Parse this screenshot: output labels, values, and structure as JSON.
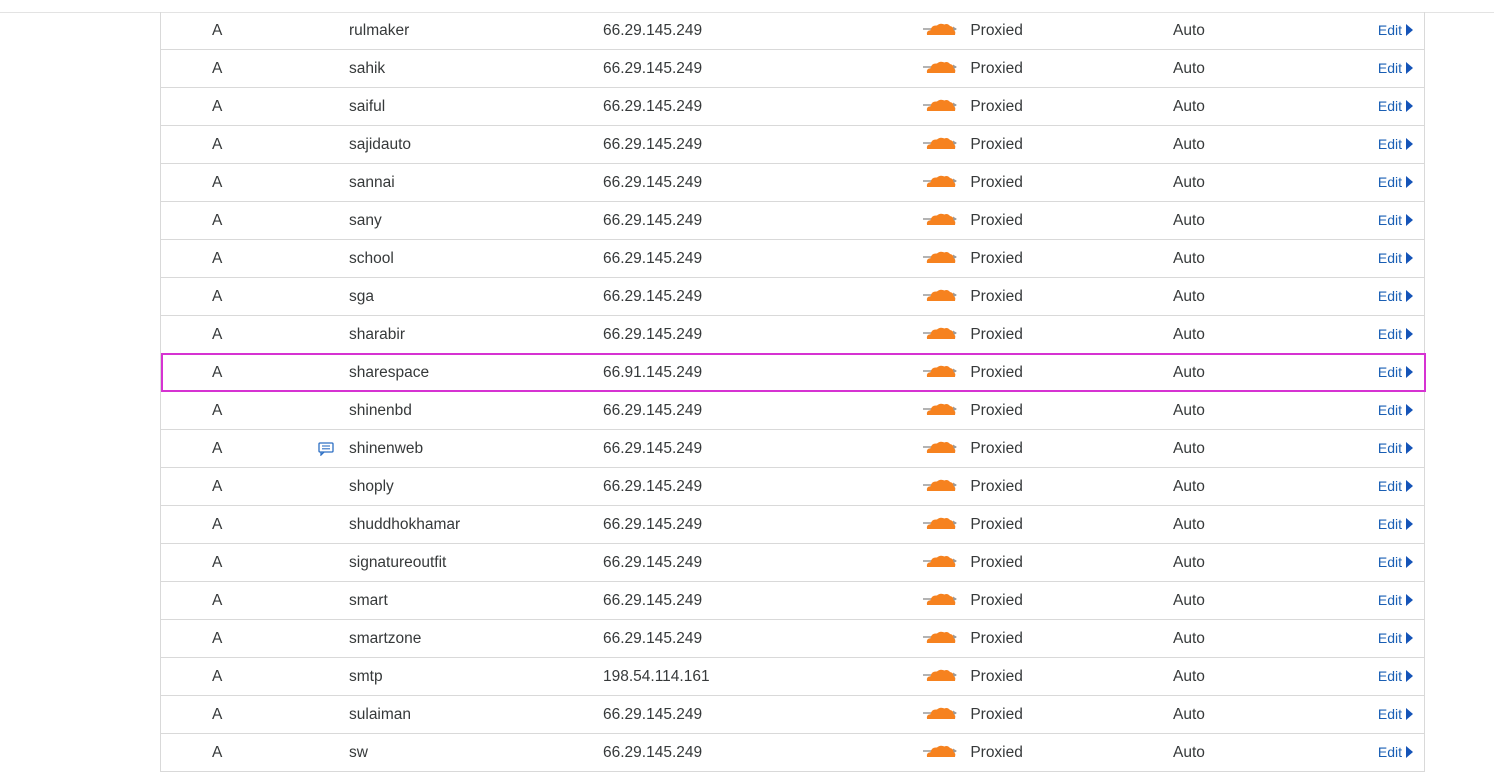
{
  "colors": {
    "accent": "#1a5fb4",
    "highlight": "#d633d2",
    "cloud": "#f6821f"
  },
  "icons": {
    "proxy": "orange-cloud-icon",
    "comment": "comment-icon",
    "edit_caret": "caret-right-icon"
  },
  "records": [
    {
      "type": "A",
      "name": "rulmaker",
      "content": "66.29.145.249",
      "proxy": "Proxied",
      "ttl": "Auto",
      "edit": "Edit"
    },
    {
      "type": "A",
      "name": "sahik",
      "content": "66.29.145.249",
      "proxy": "Proxied",
      "ttl": "Auto",
      "edit": "Edit"
    },
    {
      "type": "A",
      "name": "saiful",
      "content": "66.29.145.249",
      "proxy": "Proxied",
      "ttl": "Auto",
      "edit": "Edit"
    },
    {
      "type": "A",
      "name": "sajidauto",
      "content": "66.29.145.249",
      "proxy": "Proxied",
      "ttl": "Auto",
      "edit": "Edit"
    },
    {
      "type": "A",
      "name": "sannai",
      "content": "66.29.145.249",
      "proxy": "Proxied",
      "ttl": "Auto",
      "edit": "Edit"
    },
    {
      "type": "A",
      "name": "sany",
      "content": "66.29.145.249",
      "proxy": "Proxied",
      "ttl": "Auto",
      "edit": "Edit"
    },
    {
      "type": "A",
      "name": "school",
      "content": "66.29.145.249",
      "proxy": "Proxied",
      "ttl": "Auto",
      "edit": "Edit"
    },
    {
      "type": "A",
      "name": "sga",
      "content": "66.29.145.249",
      "proxy": "Proxied",
      "ttl": "Auto",
      "edit": "Edit"
    },
    {
      "type": "A",
      "name": "sharabir",
      "content": "66.29.145.249",
      "proxy": "Proxied",
      "ttl": "Auto",
      "edit": "Edit"
    },
    {
      "type": "A",
      "name": "sharespace",
      "content": "66.91.145.249",
      "proxy": "Proxied",
      "ttl": "Auto",
      "edit": "Edit",
      "highlighted": true
    },
    {
      "type": "A",
      "name": "shinenbd",
      "content": "66.29.145.249",
      "proxy": "Proxied",
      "ttl": "Auto",
      "edit": "Edit"
    },
    {
      "type": "A",
      "name": "shinenweb",
      "content": "66.29.145.249",
      "proxy": "Proxied",
      "ttl": "Auto",
      "edit": "Edit",
      "has_comment": true
    },
    {
      "type": "A",
      "name": "shoply",
      "content": "66.29.145.249",
      "proxy": "Proxied",
      "ttl": "Auto",
      "edit": "Edit"
    },
    {
      "type": "A",
      "name": "shuddhokhamar",
      "content": "66.29.145.249",
      "proxy": "Proxied",
      "ttl": "Auto",
      "edit": "Edit"
    },
    {
      "type": "A",
      "name": "signatureoutfit",
      "content": "66.29.145.249",
      "proxy": "Proxied",
      "ttl": "Auto",
      "edit": "Edit"
    },
    {
      "type": "A",
      "name": "smart",
      "content": "66.29.145.249",
      "proxy": "Proxied",
      "ttl": "Auto",
      "edit": "Edit"
    },
    {
      "type": "A",
      "name": "smartzone",
      "content": "66.29.145.249",
      "proxy": "Proxied",
      "ttl": "Auto",
      "edit": "Edit"
    },
    {
      "type": "A",
      "name": "smtp",
      "content": "198.54.114.161",
      "proxy": "Proxied",
      "ttl": "Auto",
      "edit": "Edit"
    },
    {
      "type": "A",
      "name": "sulaiman",
      "content": "66.29.145.249",
      "proxy": "Proxied",
      "ttl": "Auto",
      "edit": "Edit"
    },
    {
      "type": "A",
      "name": "sw",
      "content": "66.29.145.249",
      "proxy": "Proxied",
      "ttl": "Auto",
      "edit": "Edit"
    }
  ]
}
